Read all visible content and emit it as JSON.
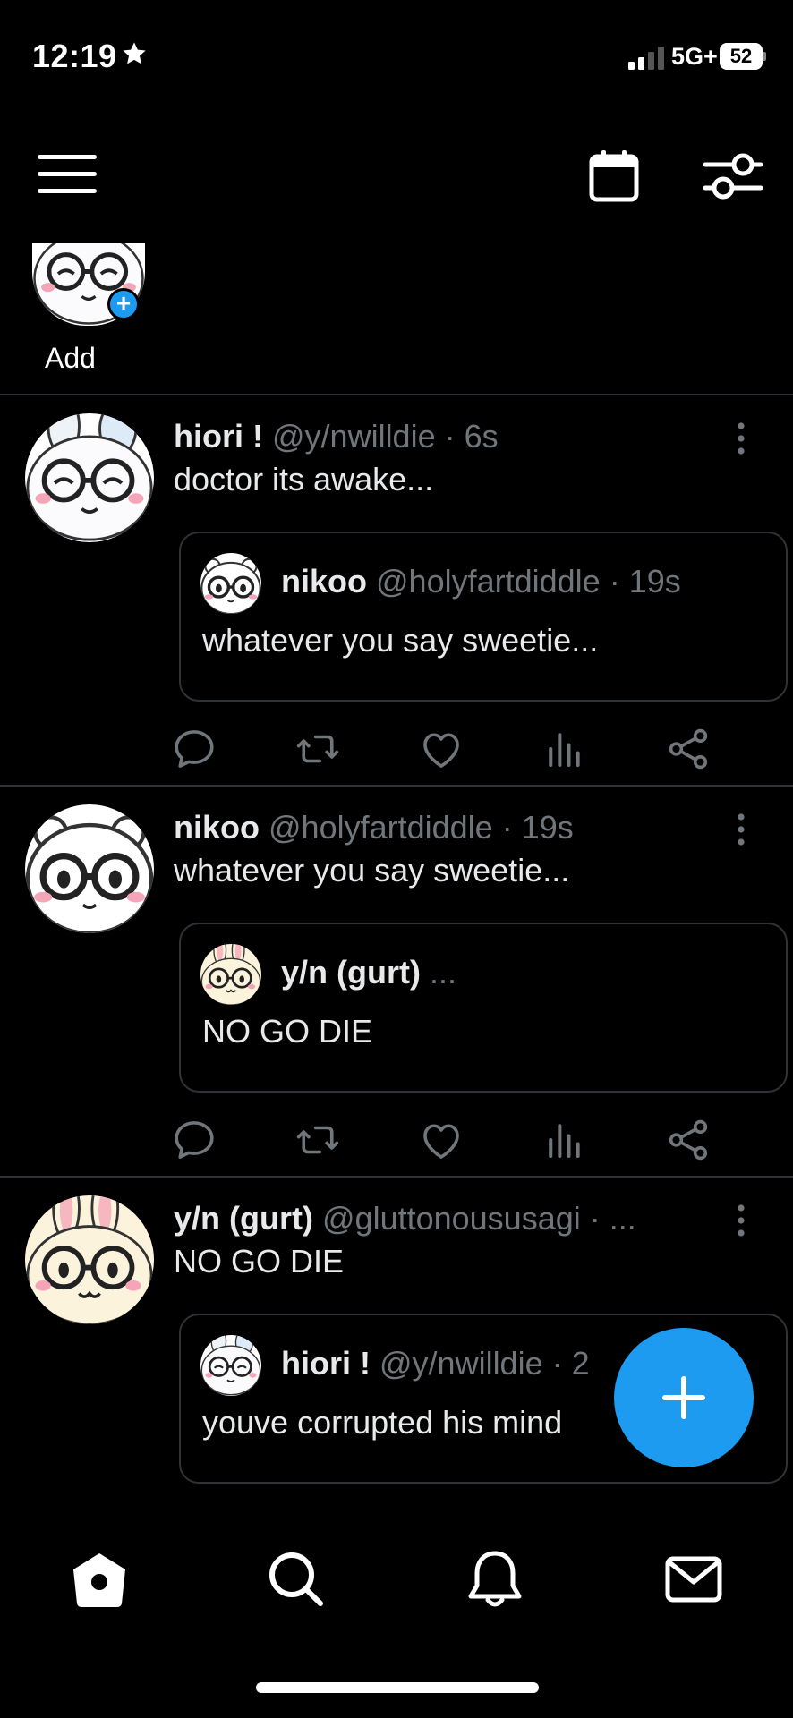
{
  "status_bar": {
    "time": "12:19",
    "network": "5G+",
    "battery": "52"
  },
  "stories": {
    "add_label": "Add"
  },
  "posts": [
    {
      "name": "hiori !",
      "meta": "@y/nwilldie · 6s",
      "text": "doctor its awake...",
      "quote": {
        "name": "nikoo",
        "meta": "@holyfartdiddle · 19s",
        "text": "whatever you say sweetie..."
      }
    },
    {
      "name": "nikoo",
      "meta": "@holyfartdiddle · 19s",
      "text": "whatever you say sweetie...",
      "quote": {
        "name": "y/n (gurt)",
        "meta": "...",
        "text": "NO GO DIE"
      }
    },
    {
      "name": "y/n (gurt)",
      "meta": "@gluttonoususagi · ...",
      "text": "NO GO DIE",
      "quote": {
        "name": "hiori !",
        "meta": "@y/nwilldie · 2",
        "text": "youve corrupted his mind"
      }
    }
  ],
  "icons": {
    "top_bar": [
      "menu-icon",
      "calendar-icon",
      "filter-icon"
    ],
    "actions": [
      "reply-icon",
      "repost-icon",
      "like-icon",
      "views-icon",
      "share-icon"
    ],
    "bottom_nav": [
      "home-icon",
      "search-icon",
      "notifications-icon",
      "messages-icon"
    ],
    "fab": "plus-icon"
  },
  "colors": {
    "accent": "#1d9bf0",
    "background": "#000000",
    "text": "#e7e9ea",
    "muted": "#71767b",
    "border": "#2f3336"
  }
}
